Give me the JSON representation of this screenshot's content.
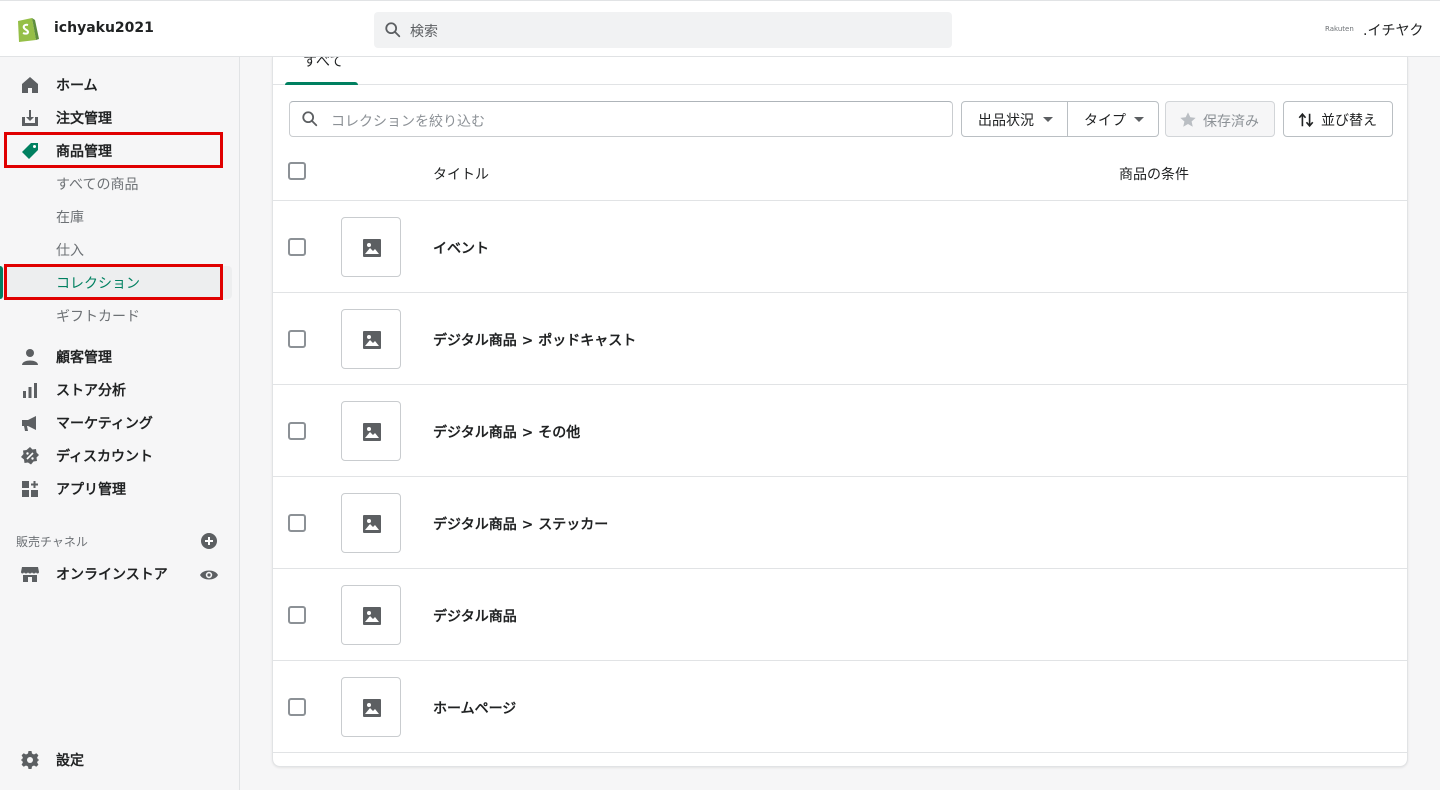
{
  "topbar": {
    "store_name": "ichyaku2021",
    "search_placeholder": "検索",
    "user_logo_text": "Rakuten",
    "user_name": ".イチヤク"
  },
  "sidebar": {
    "items": [
      {
        "label": "ホーム",
        "icon": "home-icon"
      },
      {
        "label": "注文管理",
        "icon": "orders-icon"
      },
      {
        "label": "商品管理",
        "icon": "tag-icon"
      }
    ],
    "sub_items": [
      {
        "label": "すべての商品"
      },
      {
        "label": "在庫"
      },
      {
        "label": "仕入"
      },
      {
        "label": "コレクション",
        "active": true
      },
      {
        "label": "ギフトカード"
      }
    ],
    "items2": [
      {
        "label": "顧客管理",
        "icon": "customer-icon"
      },
      {
        "label": "ストア分析",
        "icon": "analytics-icon"
      },
      {
        "label": "マーケティング",
        "icon": "megaphone-icon"
      },
      {
        "label": "ディスカウント",
        "icon": "discount-icon"
      },
      {
        "label": "アプリ管理",
        "icon": "apps-icon"
      }
    ],
    "channels_title": "販売チャネル",
    "online_store": "オンラインストア",
    "settings": "設定"
  },
  "main": {
    "tab_all": "すべて",
    "filter_placeholder": "コレクションを絞り込む",
    "btn_status": "出品状況",
    "btn_type": "タイプ",
    "btn_saved": "保存済み",
    "btn_sort": "並び替え",
    "col_title": "タイトル",
    "col_conditions": "商品の条件",
    "rows": [
      {
        "title": "イベント"
      },
      {
        "title": "デジタル商品 > ポッドキャスト"
      },
      {
        "title": "デジタル商品 > その他"
      },
      {
        "title": "デジタル商品 > ステッカー"
      },
      {
        "title": "デジタル商品"
      },
      {
        "title": "ホームページ"
      }
    ]
  },
  "colors": {
    "accent": "#008060",
    "highlight": "#e00000"
  }
}
